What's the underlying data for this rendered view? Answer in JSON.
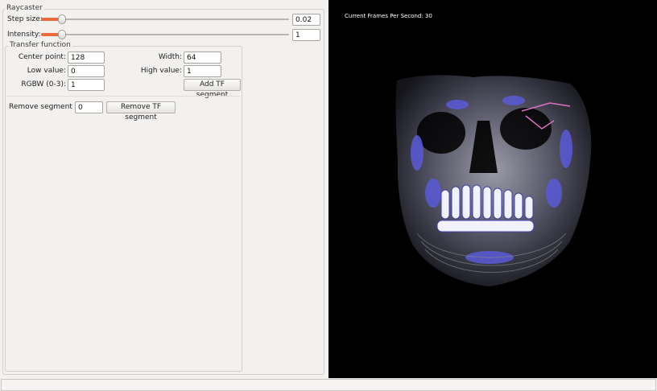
{
  "raycaster": {
    "title": "Raycaster",
    "step_size": {
      "label": "Step size:",
      "value": "0.02",
      "level": 0.03
    },
    "intensity": {
      "label": "Intensity:",
      "value": "1",
      "level": 0.03
    }
  },
  "transfer_function": {
    "title": "Transfer function",
    "center_point": {
      "label": "Center point:",
      "value": "128"
    },
    "width": {
      "label": "Width:",
      "value": "64"
    },
    "low_value": {
      "label": "Low value:",
      "value": "0"
    },
    "high_value": {
      "label": "High value:",
      "value": "1"
    },
    "rgbw": {
      "label": "RGBW (0-3):",
      "value": "1"
    },
    "add_button": "Add TF segment",
    "remove_label": "Remove segment nr.",
    "remove_value": "0",
    "remove_button": "Remove TF segment"
  },
  "viewport": {
    "fps_text": "Current Frames Per Second: 30"
  },
  "colors": {
    "slider_accent": "#e96a3a",
    "render_bg": "#000000",
    "volume_tint": "#5a5ad8"
  }
}
